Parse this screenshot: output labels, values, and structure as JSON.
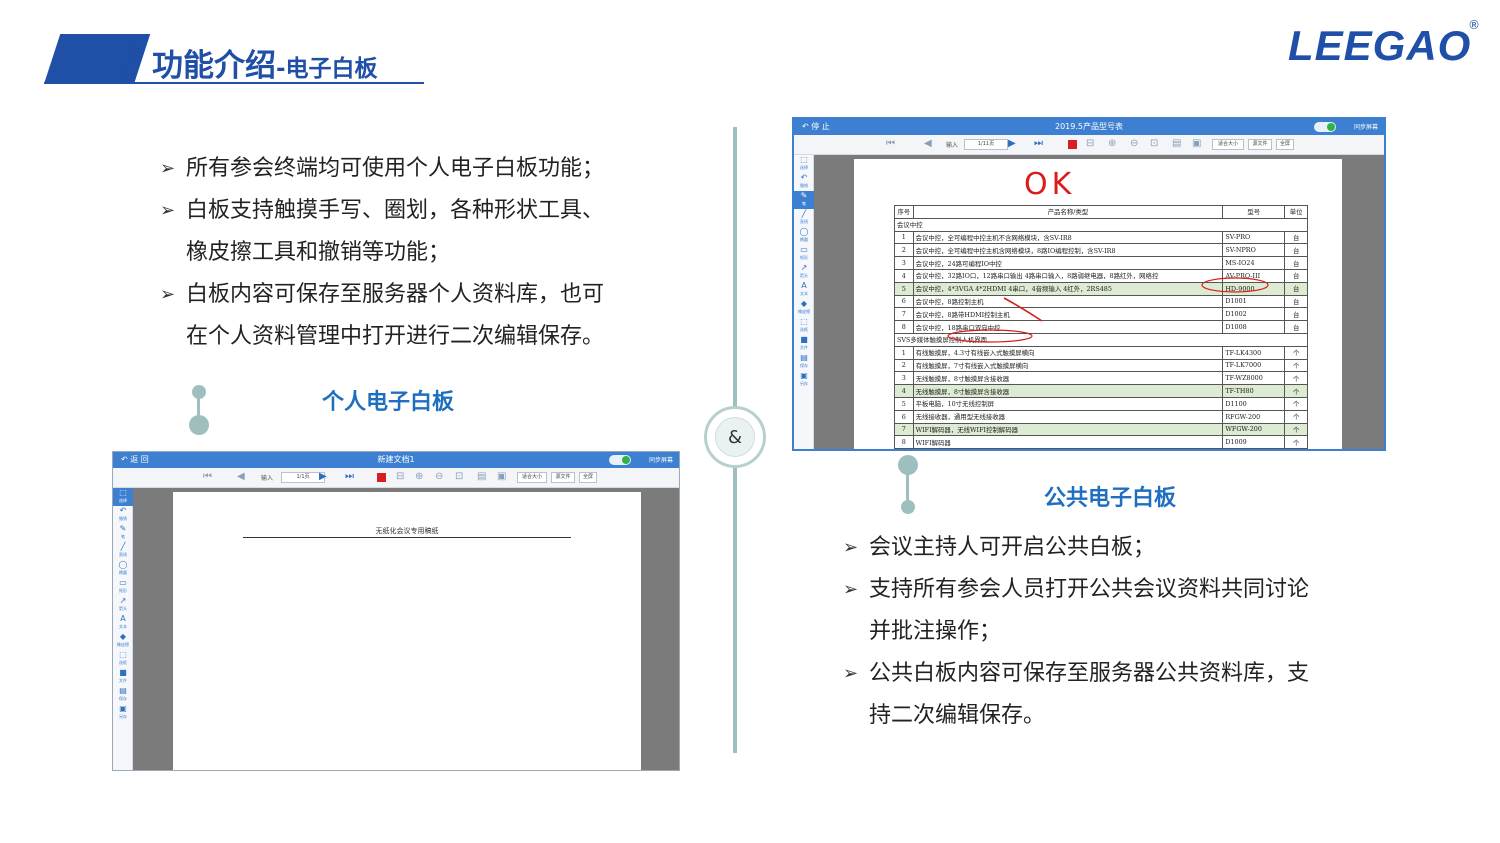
{
  "header": {
    "title_main": "功能介绍",
    "title_sub": "-电子白板"
  },
  "logo": {
    "text": "LEEGAO",
    "reg": "®"
  },
  "left_bullets": [
    {
      "line1": "所有参会终端均可使用个人电子白板功能；",
      "line2": ""
    },
    {
      "line1": "白板支持触摸手写、圈划，各种形状工具、",
      "line2": "橡皮擦工具和撤销等功能；"
    },
    {
      "line1": "白板内容可保存至服务器个人资料库，也可",
      "line2": "在个人资料管理中打开进行二次编辑保存。"
    }
  ],
  "right_bullets": [
    {
      "line1": "会议主持人可开启公共白板；",
      "line2": ""
    },
    {
      "line1": "支持所有参会人员打开公共会议资料共同讨论",
      "line2": "并批注操作；"
    },
    {
      "line1": "公共白板内容可保存至服务器公共资料库，支",
      "line2": "持二次编辑保存。"
    }
  ],
  "divider": {
    "symbol": "&"
  },
  "personal": {
    "label": "个人电子白板",
    "window": {
      "back": "返 回",
      "title": "新建文档1",
      "sync": "同步屏幕",
      "page_input": "输入",
      "page_count": "1/1页",
      "fit": "适合大小",
      "source": "源文件",
      "full": "全屏",
      "doc_heading": "无纸化会议专用稿纸",
      "tools": [
        "选择",
        "撤销",
        "笔",
        "直线",
        "椭圆",
        "矩形",
        "箭头",
        "文本",
        "橡皮擦",
        "选框",
        "文件",
        "保存",
        "另存"
      ]
    }
  },
  "public": {
    "label": "公共电子白板",
    "window": {
      "back": "停 止",
      "title": "2019.5产品型号表",
      "sync": "同步屏幕",
      "page_input": "输入",
      "page_count": "1/11页",
      "fit": "适合大小",
      "source": "源文件",
      "full": "全屏",
      "annotation": "OK",
      "tools": [
        "选择",
        "撤销",
        "笔",
        "直线",
        "椭圆",
        "矩形",
        "箭头",
        "文本",
        "橡皮擦",
        "选框",
        "文件",
        "保存",
        "另存"
      ],
      "table": {
        "headers": [
          "序号",
          "产品名称/类型",
          "型号",
          "单位"
        ],
        "group1": "会议中控",
        "rows1": [
          [
            "1",
            "会议中控，全可编程中控主机不含网络模块，含SV-IR8",
            "SV-PRO",
            "台",
            false
          ],
          [
            "2",
            "会议中控，全可编程中控主机含网络模块，8路IO编程控制，含SV-IR8",
            "SV-NPRO",
            "台",
            false
          ],
          [
            "3",
            "会议中控，24路可编程IO中控",
            "MS-IO24",
            "台",
            false
          ],
          [
            "4",
            "会议中控，32路IO口，12路串口输出 4路串口输入，8路弱继电器，8路红外，网络控",
            "AV-PRO-III",
            "台",
            false
          ],
          [
            "5",
            "会议中控，4*3VGA 4*2HDMI 4串口，4音频输入 4红外，2RS485",
            "HD-9000",
            "台",
            true
          ],
          [
            "6",
            "会议中控，8路控制主机",
            "D1001",
            "台",
            false
          ],
          [
            "7",
            "会议中控，8路带HDMI控制主机",
            "D1002",
            "台",
            false
          ],
          [
            "8",
            "会议中控，18路串口双向中控",
            "D1008",
            "台",
            false
          ]
        ],
        "group2": "SVS多媒体触摸屏控制人机界面",
        "rows2": [
          [
            "1",
            "有线触摸屏，4.3寸有线嵌入式触摸屏横向",
            "TF-LK4300",
            "个",
            false
          ],
          [
            "2",
            "有线触摸屏，7寸有线嵌入式触摸屏横向",
            "TF-LK7000",
            "个",
            false
          ],
          [
            "3",
            "无线触摸屏，8寸触摸屏含接收器",
            "TF-WZ8000",
            "个",
            false
          ],
          [
            "4",
            "无线触摸屏，8寸触摸屏含接收器",
            "TF-TH80",
            "个",
            true
          ],
          [
            "5",
            "平板电脑，10寸无线控制屏",
            "D1100",
            "个",
            false
          ],
          [
            "6",
            "无线接收器，通用型无线接收器",
            "RFGW-200",
            "个",
            false
          ],
          [
            "7",
            "WIFI解码器，无线WIFI控制解码器",
            "WFGW-200",
            "个",
            true
          ],
          [
            "8",
            "WIFI解码器",
            "D1009",
            "个",
            false
          ]
        ]
      }
    }
  },
  "colors": {
    "brand_blue": "#1f4fa6",
    "label_blue": "#1f6fc0",
    "divider_teal": "#9fbfbf",
    "app_titlebar": "#3d7fd0",
    "highlight_row": "#dcebd2",
    "annotation_red": "#d91c1c"
  },
  "icons": [
    "arrow-bullet-icon",
    "back-arrow-icon",
    "first-page-icon",
    "prev-page-icon",
    "next-page-icon",
    "last-page-icon",
    "red-color-swatch-icon",
    "minus-icon",
    "zoom-in-icon",
    "zoom-out-icon",
    "zoom-reset-icon",
    "save-icon",
    "export-icon"
  ]
}
